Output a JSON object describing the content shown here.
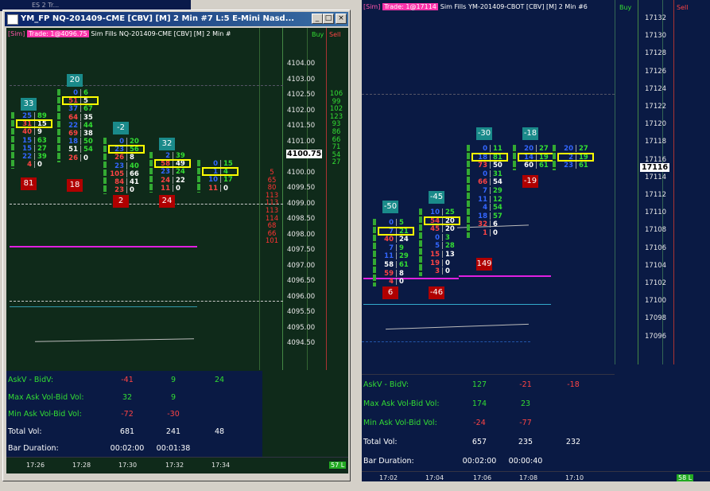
{
  "bg_tab": {
    "label": "ES 2 Tr..."
  },
  "left": {
    "title": "YM_FP  NQ-201409-CME [CBV] [M]  2 Min   #7  L:5  E-Mini Nasd...",
    "sim_badge": "[Sim]",
    "trade_text": "Trade: 1@4096.75",
    "fills": "Sim Fills",
    "header_rest": "NQ-201409-CME [CBV] [M]  2 Min   #",
    "buy_label": "Buy",
    "sell_label": "Sell",
    "prices": [
      "4104.00",
      "4103.00",
      "4102.50",
      "4102.00",
      "4101.50",
      "4101.00",
      "4100.50",
      "4100.00",
      "4099.50",
      "4099.00",
      "4098.50",
      "4098.00",
      "4097.50",
      "4097.00",
      "4096.50",
      "4096.00",
      "4095.50",
      "4095.00",
      "4094.50"
    ],
    "current_price": "4100.75",
    "buy_column": [
      "106",
      "99",
      "102",
      "123",
      "93",
      "86",
      "66",
      "71",
      "54",
      "27"
    ],
    "sell_column": [
      "5",
      "65",
      "80",
      "113",
      "113",
      "113",
      "114",
      "68",
      "66",
      "101"
    ],
    "deltas_top": [
      "33",
      "20",
      "-2",
      "32"
    ],
    "deltas_bottom": [
      "81",
      "18",
      "2",
      "24"
    ],
    "bars": [
      {
        "rows": [
          [
            "25",
            "89"
          ],
          [
            "31",
            "15"
          ],
          [
            "40",
            "9"
          ],
          [
            "15",
            "63"
          ],
          [
            "15",
            "27"
          ],
          [
            "22",
            "39"
          ],
          [
            "4",
            "0"
          ]
        ]
      },
      {
        "rows": [
          [
            "0",
            "6"
          ],
          [
            "51",
            "5"
          ],
          [
            "37",
            "67"
          ],
          [
            "64",
            "35"
          ],
          [
            "22",
            "44"
          ],
          [
            "69",
            "38"
          ],
          [
            "18",
            "50"
          ],
          [
            "51",
            "54"
          ],
          [
            "26",
            "0"
          ]
        ]
      },
      {
        "rows": [
          [
            "0",
            "20"
          ],
          [
            "23",
            "56"
          ],
          [
            "26",
            "8"
          ],
          [
            "23",
            "40"
          ],
          [
            "105",
            "66"
          ],
          [
            "84",
            "41"
          ],
          [
            "23",
            "0"
          ]
        ]
      },
      {
        "rows": [
          [
            "2",
            "39"
          ],
          [
            "58",
            "49"
          ],
          [
            "23",
            "24"
          ],
          [
            "24",
            "22"
          ],
          [
            "11",
            "0"
          ]
        ]
      },
      {
        "rows": [
          [
            "0",
            "15"
          ],
          [
            "1",
            "4"
          ],
          [
            "10",
            "17"
          ],
          [
            "11",
            "0"
          ]
        ]
      }
    ],
    "stats": {
      "labels": [
        "AskV - BidV:",
        "Max Ask Vol-Bid Vol:",
        "Min Ask Vol-Bid Vol:",
        "Total Vol:",
        "Bar Duration:"
      ],
      "col1": [
        "-41",
        "32",
        "-72",
        "681",
        "00:02:00"
      ],
      "col2": [
        "9",
        "9",
        "-30",
        "241",
        "00:01:38"
      ],
      "col3": [
        "24",
        "",
        "",
        "48",
        ""
      ]
    },
    "times": [
      "17:26",
      "17:28",
      "17:30",
      "17:32",
      "17:34"
    ],
    "scale_badge": "57 L"
  },
  "right": {
    "sim_badge": "[Sim]",
    "trade_text": "Trade: 1@17114",
    "fills": "Sim Fills",
    "header_rest": "YM-201409-CBOT [CBV] [M]  2 Min   #6",
    "buy_label": "Buy",
    "sell_label": "Sell",
    "prices": [
      "17132",
      "17130",
      "17128",
      "17126",
      "17124",
      "17122",
      "17120",
      "17118",
      "17116",
      "17114",
      "17112",
      "17110",
      "17108",
      "17106",
      "17104",
      "17102",
      "17100",
      "17098",
      "17096"
    ],
    "current_price": "17116",
    "deltas_top": [
      "-50",
      "-45",
      "-30",
      "-18"
    ],
    "deltas_bottom": [
      "6",
      "-46",
      "149",
      "-19"
    ],
    "bars": [
      {
        "rows": [
          [
            "0",
            "5"
          ],
          [
            "7",
            "21"
          ],
          [
            "40",
            "24"
          ],
          [
            "7",
            "9"
          ],
          [
            "11",
            "29"
          ],
          [
            "58",
            "61"
          ],
          [
            "59",
            "8"
          ],
          [
            "4",
            "0"
          ]
        ]
      },
      {
        "rows": [
          [
            "10",
            "25"
          ],
          [
            "54",
            "20"
          ],
          [
            "45",
            "20"
          ],
          [
            "0",
            "3"
          ],
          [
            "5",
            "28"
          ],
          [
            "15",
            "13"
          ],
          [
            "19",
            "0"
          ],
          [
            "3",
            "0"
          ]
        ]
      },
      {
        "rows": [
          [
            "0",
            "11"
          ],
          [
            "18",
            "81"
          ],
          [
            "73",
            "50"
          ],
          [
            "0",
            "31"
          ],
          [
            "66",
            "54"
          ],
          [
            "7",
            "29"
          ],
          [
            "11",
            "12"
          ],
          [
            "4",
            "54"
          ],
          [
            "18",
            "57"
          ],
          [
            "32",
            "6"
          ],
          [
            "1",
            "0"
          ]
        ]
      },
      {
        "rows": [
          [
            "20",
            "27"
          ],
          [
            "14",
            "19"
          ],
          [
            "60",
            "61"
          ]
        ]
      },
      {
        "rows": [
          [
            "20",
            "27"
          ],
          [
            "2",
            "19"
          ],
          [
            "23",
            "61"
          ]
        ]
      }
    ],
    "stats": {
      "labels": [
        "AskV - BidV:",
        "Max Ask Vol-Bid Vol:",
        "Min Ask Vol-Bid Vol:",
        "Total Vol:",
        "Bar Duration:"
      ],
      "col1": [
        "127",
        "174",
        "-24",
        "657",
        "00:02:00"
      ],
      "col2": [
        "-21",
        "23",
        "-77",
        "235",
        "00:00:40"
      ],
      "col3": [
        "-18",
        "",
        "",
        "232",
        ""
      ]
    },
    "times": [
      "17:02",
      "17:04",
      "17:06",
      "17:08",
      "17:10"
    ],
    "scale_badge": "58 L"
  }
}
